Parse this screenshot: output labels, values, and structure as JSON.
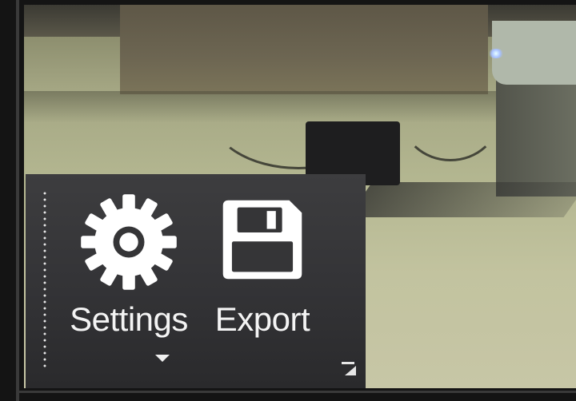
{
  "toolbar": {
    "settings": {
      "label": "Settings",
      "icon": "gear-icon",
      "has_dropdown": true
    },
    "export": {
      "label": "Export",
      "icon": "floppy-disk-icon"
    },
    "overflow_icon": "panel-launcher-icon"
  },
  "colors": {
    "toolbar_background": "#353537",
    "icon_color": "#ffffff",
    "label_color": "#f4f4f4"
  }
}
